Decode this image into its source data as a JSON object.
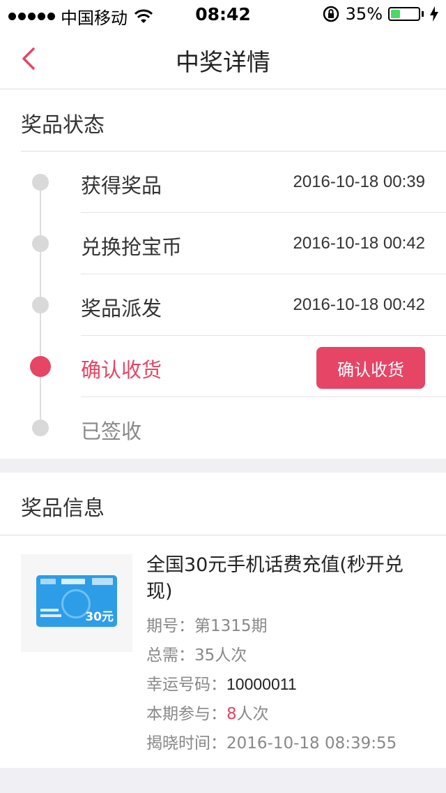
{
  "status_bar": {
    "carrier": "中国移动",
    "time": "08:42",
    "battery_text": "35%",
    "battery_level": 0.35,
    "battery_color": "#4cd964"
  },
  "nav": {
    "title": "中奖详情",
    "back_icon": "chevron-left-icon"
  },
  "status_section": {
    "title": "奖品状态",
    "steps": [
      {
        "label": "获得奖品",
        "time": "2016-10-18 00:39"
      },
      {
        "label": "兑换抢宝币",
        "time": "2016-10-18 00:42"
      },
      {
        "label": "奖品派发",
        "time": "2016-10-18 00:42"
      },
      {
        "label": "确认收货",
        "button": "确认收货"
      },
      {
        "label": "已签收"
      }
    ]
  },
  "info_section": {
    "title": "奖品信息",
    "card_value": "30元",
    "prize_name": "全国30元手机话费充值(秒开兑现)",
    "rows": [
      {
        "label": "期号：",
        "value": "第1315期"
      },
      {
        "label": "总需：",
        "value": "35人次"
      },
      {
        "label": "幸运号码：",
        "value": "10000011"
      },
      {
        "label": "本期参与：",
        "value_highlight": "8",
        "value_suffix": "人次"
      },
      {
        "label": "揭晓时间：",
        "value": "2016-10-18 08:39:55"
      }
    ]
  },
  "colors": {
    "accent": "#e64565",
    "muted_dot": "#d9d9d9",
    "background": "#efeff4"
  }
}
